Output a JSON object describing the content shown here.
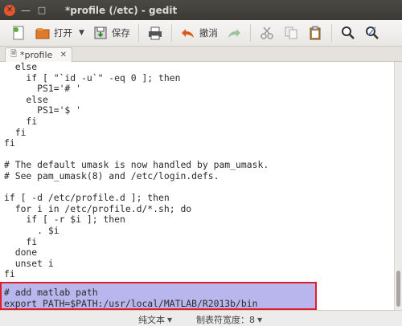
{
  "window": {
    "title": "*profile (/etc) - gedit",
    "close_glyph": "✕",
    "minimize_glyph": "—",
    "maximize_glyph": "□"
  },
  "toolbar": {
    "open_label": "打开",
    "save_label": "保存",
    "undo_label": "撤消",
    "dropdown_glyph": "▼"
  },
  "tab": {
    "label": "*profile",
    "close_glyph": "✕"
  },
  "editor": {
    "lines": [
      "  else",
      "    if [ \"`id -u`\" -eq 0 ]; then",
      "      PS1='# '",
      "    else",
      "      PS1='$ '",
      "    fi",
      "  fi",
      "fi",
      "",
      "# The default umask is now handled by pam_umask.",
      "# See pam_umask(8) and /etc/login.defs.",
      "",
      "if [ -d /etc/profile.d ]; then",
      "  for i in /etc/profile.d/*.sh; do",
      "    if [ -r $i ]; then",
      "      . $i",
      "    fi",
      "  done",
      "  unset i",
      "fi",
      "",
      "# add matlab path",
      "export PATH=$PATH:/usr/local/MATLAB/R2013b/bin"
    ]
  },
  "statusbar": {
    "language": "纯文本",
    "tab_width": "制表符宽度：8"
  },
  "colors": {
    "highlight_fill": "#b9b6ee",
    "highlight_border": "#e21d2a"
  }
}
